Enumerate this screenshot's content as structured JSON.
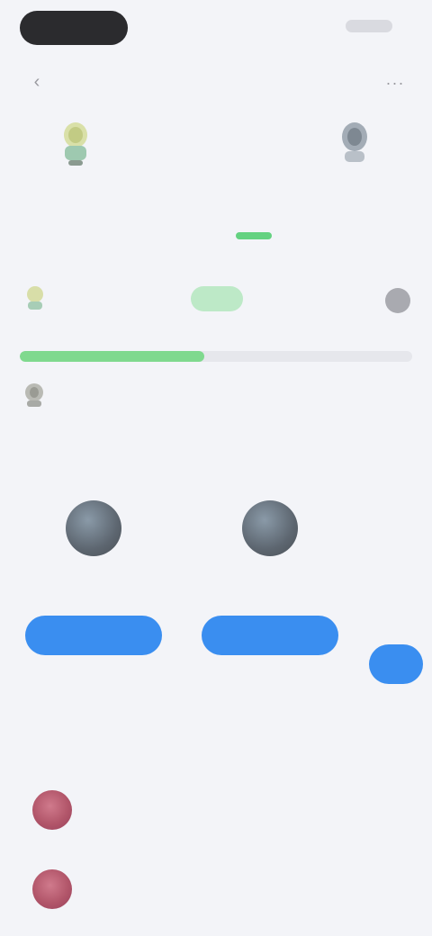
{
  "status": {
    "time": "",
    "indicators": ""
  },
  "header": {
    "title": "",
    "back_icon": "chevron-left-icon",
    "more_icon": "more-horizontal-icon"
  },
  "match": {
    "home_score": "",
    "separator": "",
    "away_score": ""
  },
  "tabs": [
    {
      "label": ""
    },
    {
      "label": ""
    },
    {
      "label": ""
    },
    {
      "label": ""
    },
    {
      "label": ""
    },
    {
      "label": ""
    }
  ],
  "active_tab_index": 3,
  "bet_section": {
    "title": "",
    "link": "",
    "team_name": "",
    "odds": "",
    "amount": "",
    "caption_left": "",
    "caption_right": "",
    "progress_fraction": 0.47
  },
  "suggested": {
    "title": "",
    "users": [
      {
        "name": "",
        "meta_left": "",
        "meta_right": "",
        "button": ""
      },
      {
        "name": "",
        "meta_left": "",
        "meta_right": "",
        "button": ""
      },
      {
        "name": "",
        "meta_left": "",
        "meta_right": "",
        "button": ""
      }
    ]
  },
  "fans": {
    "title": "",
    "link": "",
    "items": [
      {
        "name": "",
        "value": ""
      },
      {
        "name": "",
        "value": ""
      }
    ]
  },
  "colors": {
    "accent_blue": "#3a8ef0",
    "accent_green": "#34c759",
    "background": "#f3f4f8"
  }
}
